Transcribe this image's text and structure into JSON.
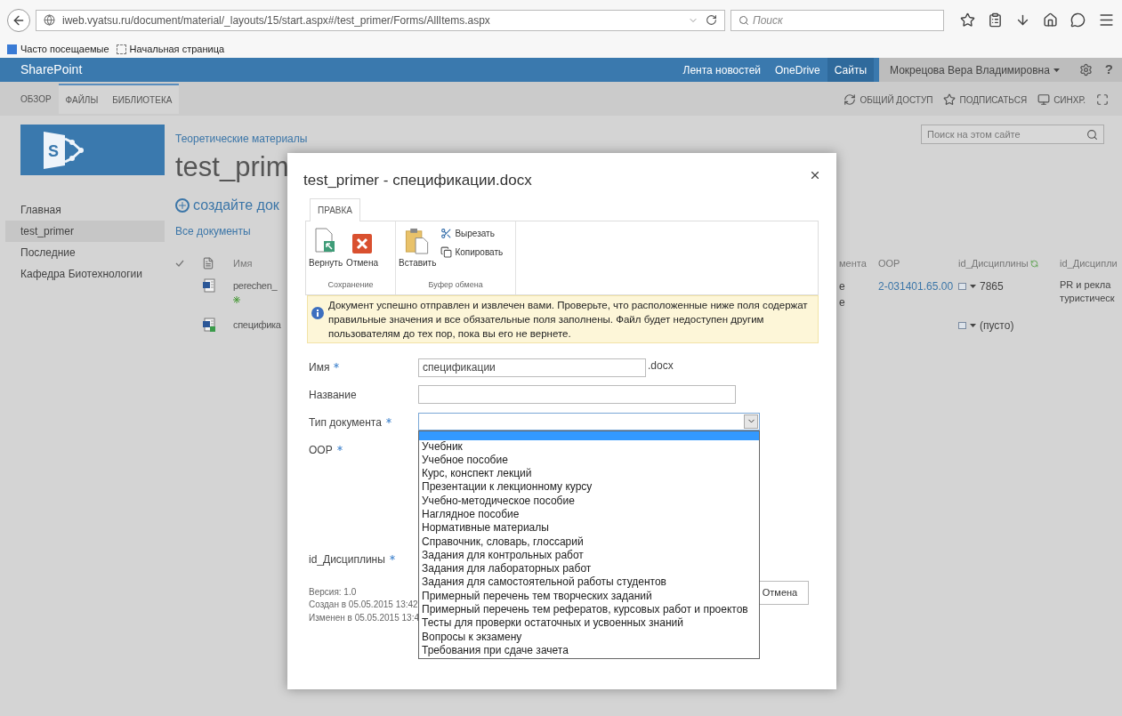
{
  "browser": {
    "url": "iweb.vyatsu.ru/document/material/_layouts/15/start.aspx#/test_primer/Forms/AllItems.aspx",
    "search": {
      "placeholder": "Поиск"
    },
    "bookmarks": [
      "Часто посещаемые",
      "Начальная страница"
    ]
  },
  "suite_bar": {
    "brand": "SharePoint",
    "links": [
      {
        "label": "Лента новостей",
        "selected": false
      },
      {
        "label": "OneDrive",
        "selected": false
      },
      {
        "label": "Сайты",
        "selected": true
      }
    ],
    "user": "Мокрецова Вера Владимировна",
    "help": "?"
  },
  "ribbon": {
    "tabs": [
      {
        "label": "ОБЗОР",
        "kind": "plain"
      },
      {
        "label": "ФАЙЛЫ",
        "kind": "contextual"
      },
      {
        "label": "БИБЛИОТЕКА",
        "kind": "contextual"
      }
    ],
    "actions": [
      {
        "kind": "share",
        "label": "ОБЩИЙ ДОСТУП"
      },
      {
        "kind": "follow",
        "label": "ПОДПИСАТЬСЯ"
      },
      {
        "kind": "sync",
        "label": "СИНХР."
      }
    ]
  },
  "logo": {
    "letter": "S"
  },
  "site": {
    "breadcrumb": "Теоретические материалы",
    "title": "test_prim",
    "search": {
      "placeholder": "Поиск на этом сайте"
    }
  },
  "nav": [
    {
      "label": "Главная",
      "selected": false
    },
    {
      "label": "test_primer",
      "selected": true
    },
    {
      "label": "Последние",
      "selected": false
    },
    {
      "label": "Кафедра Биотехнологии",
      "selected": false
    }
  ],
  "new_document": "создайте док",
  "view": "Все документы",
  "table": {
    "columns": [
      "Имя",
      "мента",
      "ООР",
      "id_Дисциплины",
      "id_Дисципли"
    ],
    "rows": [
      {
        "name": "perechen_",
        "new": true,
        "checked_out": false,
        "column_2": "е\nе",
        "oop": "2-031401.65.00",
        "discipline_id": "7865",
        "column_5": "PR и рекла\nтуристическ"
      },
      {
        "name": "специфика",
        "new": false,
        "checked_out": true,
        "discipline_id": "(пусто)"
      }
    ]
  },
  "dialog": {
    "title": "test_primer - спецификации.docx",
    "ribbon_tab": "ПРАВКА",
    "groups": [
      {
        "label": "Сохранение",
        "buttons": [
          {
            "kind": "checkin",
            "label": "Вернуть"
          },
          {
            "kind": "discard",
            "label": "Отмена"
          }
        ]
      },
      {
        "label": "Буфер обмена",
        "buttons": [
          {
            "kind": "paste",
            "label": "Вставить"
          },
          {
            "kind": "cut",
            "label": "Вырезать"
          },
          {
            "kind": "copy",
            "label": "Копировать"
          }
        ]
      }
    ],
    "message": "Документ успешно отправлен и извлечен вами. Проверьте, что расположенные ниже поля содержат правильные значения и все обязательные поля заполнены. Файл будет недоступен другим пользователям до тех пор, пока вы его не вернете.",
    "fields": [
      {
        "kind": "text",
        "label": "Имя",
        "required": true,
        "value": "спецификации",
        "suffix": ".docx"
      },
      {
        "kind": "text",
        "label": "Название",
        "required": false
      },
      {
        "kind": "select",
        "label": "Тип документа",
        "required": true,
        "options": [
          {
            "selected": true
          },
          {
            "label": "Учебник",
            "selected": false
          },
          {
            "label": "Учебное пособие",
            "selected": false
          },
          {
            "label": "Курс, конспект лекций",
            "selected": false
          },
          {
            "label": "Презентации к лекционному курсу",
            "selected": false
          },
          {
            "label": "Учебно-методическое пособие",
            "selected": false
          },
          {
            "label": "Наглядное пособие",
            "selected": false
          },
          {
            "label": "Нормативные материалы",
            "selected": false
          },
          {
            "label": "Справочник, словарь, глоссарий",
            "selected": false
          },
          {
            "label": "Задания для контрольных работ",
            "selected": false
          },
          {
            "label": "Задания для лабораторных работ",
            "selected": false
          },
          {
            "label": "Задания для самостоятельной работы студентов",
            "selected": false
          },
          {
            "label": "Примерный перечень тем творческих заданий",
            "selected": false
          },
          {
            "label": "Примерный перечень тем рефератов, курсовых работ и проектов",
            "selected": false
          },
          {
            "label": "Тесты для проверки остаточных и усвоенных знаний",
            "selected": false
          },
          {
            "label": "Вопросы к экзамену",
            "selected": false
          },
          {
            "label": "Требования при сдаче зачета",
            "selected": false
          }
        ]
      },
      {
        "kind": "covered_tall",
        "label": "ООР",
        "required": true
      },
      {
        "kind": "covered",
        "label": "id_Дисциплины",
        "required": true
      }
    ],
    "meta": [
      "Версия: 1.0",
      "Создан в 05.05.2015 13:42",
      "Изменен в 05.05.2015 13:4"
    ],
    "cancel": "Отмена"
  }
}
